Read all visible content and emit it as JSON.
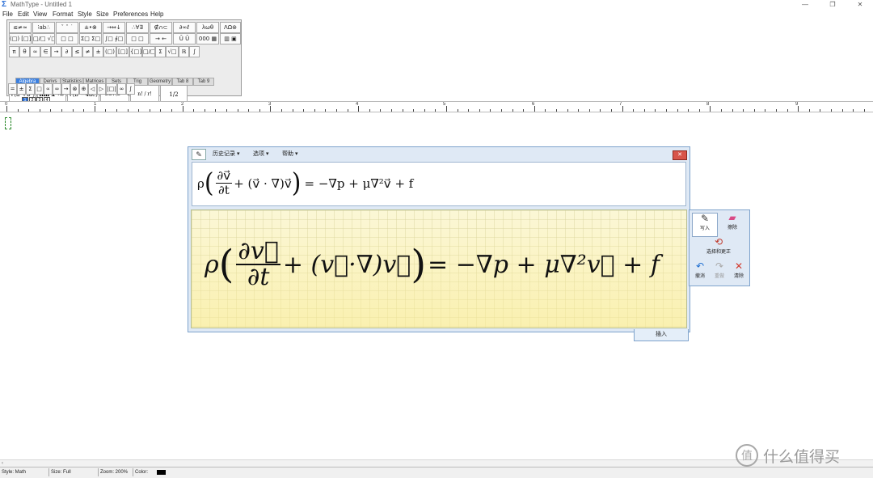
{
  "window": {
    "title": "MathType - Untitled 1",
    "controls": [
      "—",
      "❐",
      "✕"
    ]
  },
  "menu": [
    "File",
    "Edit",
    "View",
    "Format",
    "Style",
    "Size",
    "Preferences",
    "Help"
  ],
  "palette": {
    "row1": [
      "≤≠≈",
      "⁝ab∴",
      "ˇ ˆ ˙",
      "±•⊗",
      "→⇔↓",
      "∴∀∃",
      "∉∩⊂",
      "∂∞ℓ",
      "λωθ",
      "ΛΩ⊛"
    ],
    "row2": [
      "(□) [□]",
      "□/□ √□",
      "□ □",
      "Σ□ Σ□",
      "∫□ ∮□",
      "□ □",
      "→ ←",
      "Ū Ũ",
      "000 ▦",
      "▥ ▣"
    ],
    "row3": [
      "π",
      "θ",
      "∞",
      "∈",
      "→",
      "∂",
      "≤",
      "≠",
      "±",
      "(□)",
      "[□]",
      "{□}",
      "□/□",
      "Σ",
      "√□",
      "ℝ",
      "∫"
    ],
    "tabs": [
      "Algebra",
      "Derivs",
      "Statistics",
      "Matrices",
      "Sets",
      "Trig",
      "Geometry",
      "Tab 8",
      "Tab 9"
    ],
    "templates": [
      "√(a²+b²)",
      "lim x→∞",
      "√(b²−4ac)",
      "−b±√(b²−4ac) / 2a",
      "n! / r!(n−r)!",
      "1/2"
    ],
    "row5": [
      "=",
      "±",
      "Σ",
      "□",
      "∝",
      "∞",
      "→",
      "⊗",
      "⊕",
      "◁",
      "▷",
      "|□|",
      "∞",
      "∫"
    ]
  },
  "doc_tabs": [
    "1",
    "2",
    "3",
    "4"
  ],
  "ruler_numbers": [
    "0",
    "1",
    "2",
    "3",
    "4",
    "5",
    "6",
    "7",
    "8",
    "9"
  ],
  "ink_dialog": {
    "menu": [
      "历史记录 ▾",
      "选项 ▾",
      "帮助 ▾"
    ],
    "recognized": {
      "rho": "ρ",
      "num": "∂v⃗",
      "den": "∂t",
      "rest": "+ (v⃗ · ∇)v⃗",
      "rhs": "= −∇p + μ∇²v⃗ + f"
    },
    "handwriting": {
      "rho": "ρ",
      "num": "∂v⃗",
      "den": "∂t",
      "rest": "+ (v⃗·∇)v⃗",
      "rhs": "= −∇p + μ∇²v⃗ + f"
    },
    "insert_label": "插入"
  },
  "tools": {
    "write": "写入",
    "erase": "擦除",
    "select_correct": "选择和更正",
    "undo": "撤消",
    "redo": "重做",
    "clear": "清除"
  },
  "status": {
    "style": "Style: Math",
    "size": "Size: Full",
    "zoom": "Zoom: 200%",
    "color_label": "Color:",
    "color_value": "#000000"
  },
  "watermark": {
    "logo_char": "值",
    "text": "什么值得买"
  }
}
